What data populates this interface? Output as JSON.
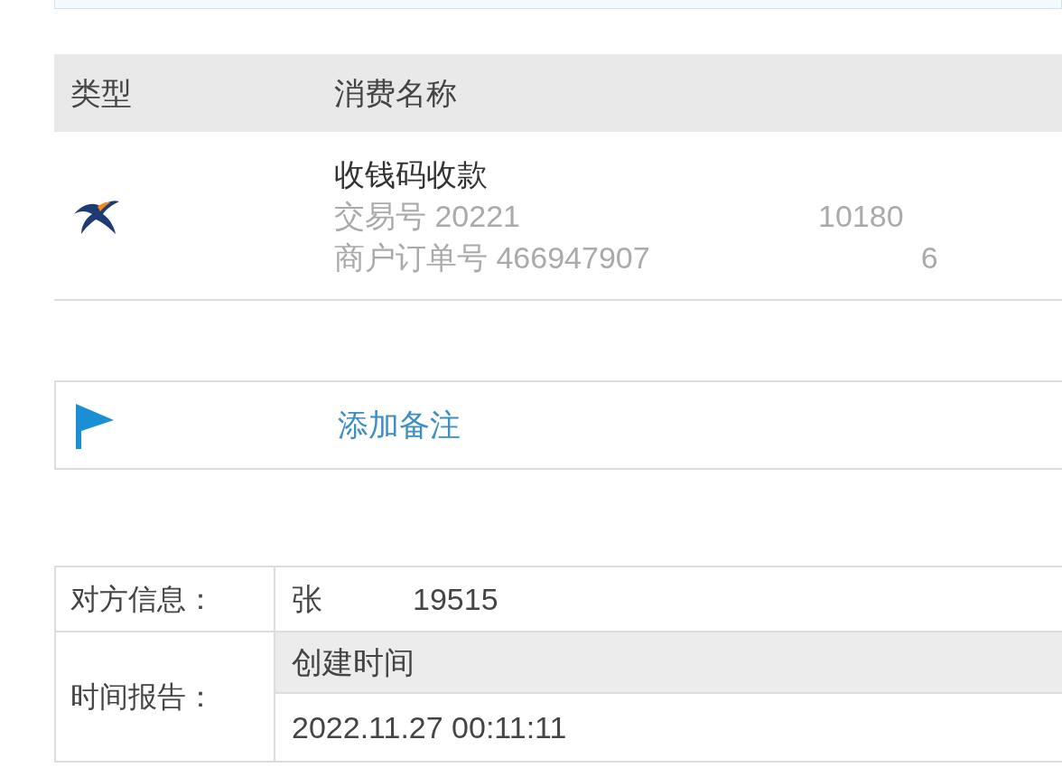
{
  "bill_table": {
    "columns": [
      "类型",
      "消费名称"
    ],
    "rows": [
      {
        "name": "收钱码收款",
        "trade_no": "交易号 20221",
        "trade_no_tail": "10180",
        "order_no": "商户订单号 466947907",
        "order_no_tail": "6"
      }
    ]
  },
  "note": {
    "link": "添加备注"
  },
  "info": {
    "counterparty_label": "对方信息：",
    "counterparty_name": "张",
    "counterparty_phone": "19515",
    "time_label": "时间报告：",
    "time_header": "创建时间",
    "time_value": "2022.11.27 00:11:11"
  }
}
